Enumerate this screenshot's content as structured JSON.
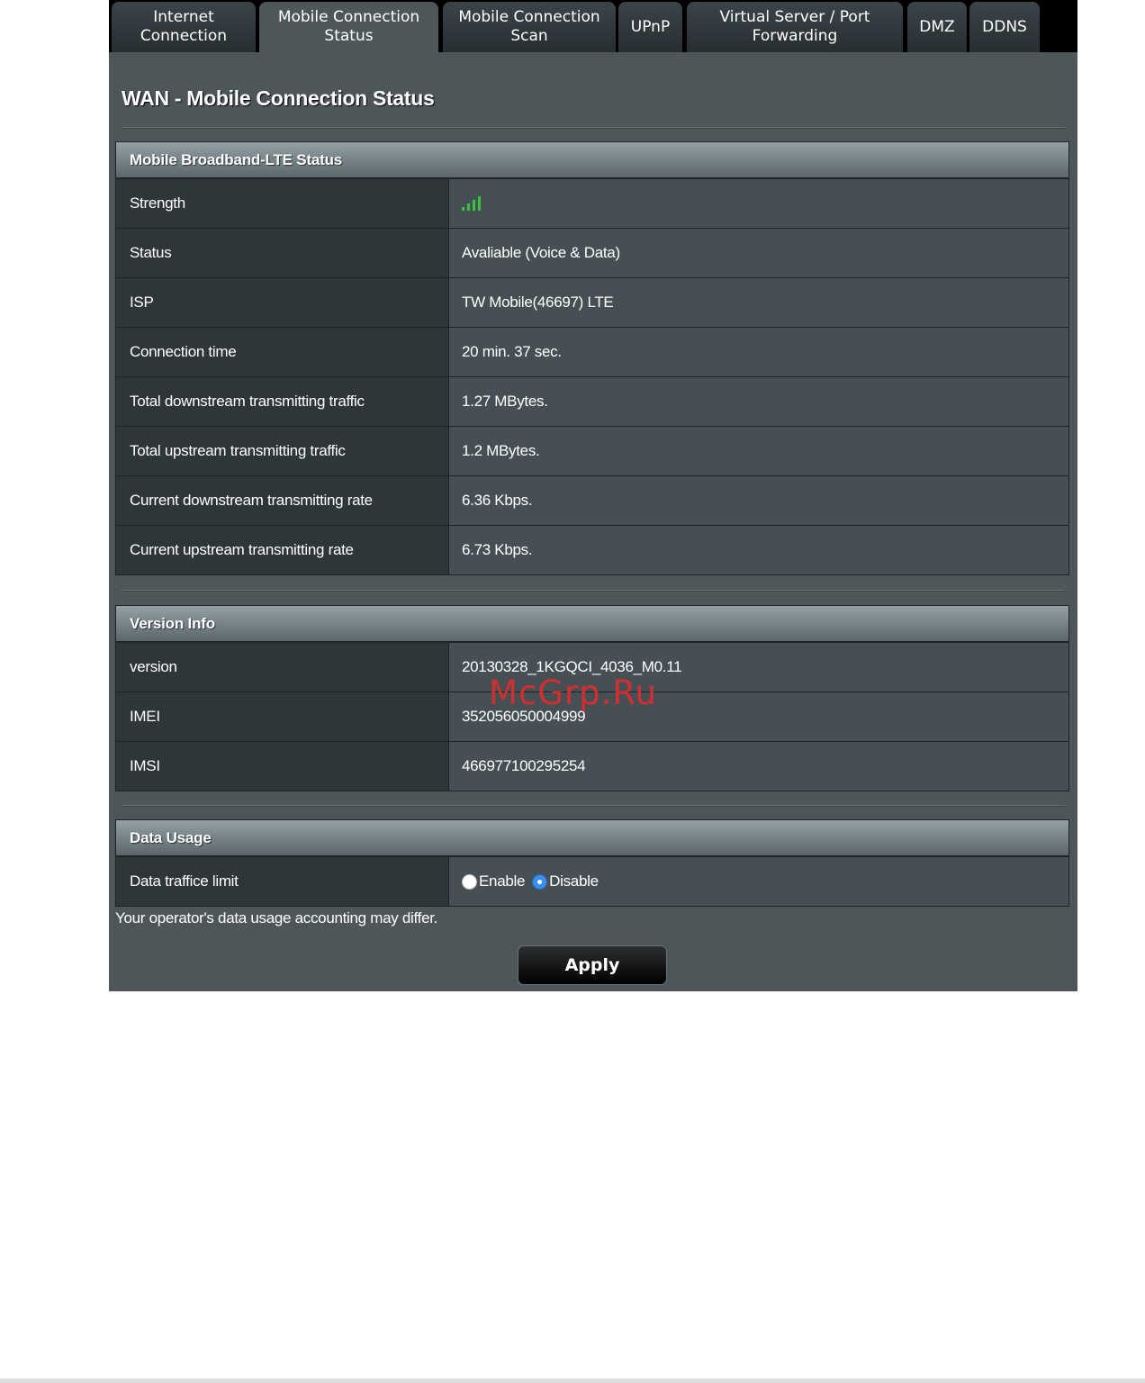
{
  "tabs": [
    {
      "label": "Internet\nConnection",
      "active": false
    },
    {
      "label": "Mobile Connection\nStatus",
      "active": true
    },
    {
      "label": "Mobile Connection\nScan",
      "active": false
    },
    {
      "label": "UPnP",
      "active": false
    },
    {
      "label": "Virtual Server / Port\nForwarding",
      "active": false
    },
    {
      "label": "DMZ",
      "active": false
    },
    {
      "label": "DDNS",
      "active": false
    }
  ],
  "page_title": "WAN - Mobile Connection Status",
  "lte_status": {
    "header": "Mobile Broadband-LTE Status",
    "strength_label": "Strength",
    "strength_bars": 4,
    "rows": [
      {
        "label": "Status",
        "value": "Avaliable (Voice & Data)"
      },
      {
        "label": "ISP",
        "value": "TW Mobile(46697) LTE"
      },
      {
        "label": "Connection time",
        "value": "20 min. 37 sec."
      },
      {
        "label": "Total downstream transmitting traffic",
        "value": "1.27 MBytes."
      },
      {
        "label": "Total upstream transmitting traffic",
        "value": "1.2 MBytes."
      },
      {
        "label": "Current downstream transmitting rate",
        "value": "6.36 Kbps."
      },
      {
        "label": "Current upstream transmitting rate",
        "value": "6.73 Kbps."
      }
    ]
  },
  "version_info": {
    "header": "Version Info",
    "rows": [
      {
        "label": "version",
        "value": "20130328_1KGQCI_4036_M0.11"
      },
      {
        "label": "IMEI",
        "value": "352056050004999"
      },
      {
        "label": "IMSI",
        "value": "466977100295254"
      }
    ]
  },
  "data_usage": {
    "header": "Data Usage",
    "limit_label": "Data traffice limit",
    "enable_label": "Enable",
    "disable_label": "Disable",
    "selected": "Disable"
  },
  "note": "Your operator's data usage accounting may differ.",
  "apply_label": "Apply",
  "watermark": "McGrp.Ru",
  "colors": {
    "signal": "#38c43a",
    "radio_checked": "#3b8ef0",
    "watermark": "#e12c2c"
  }
}
